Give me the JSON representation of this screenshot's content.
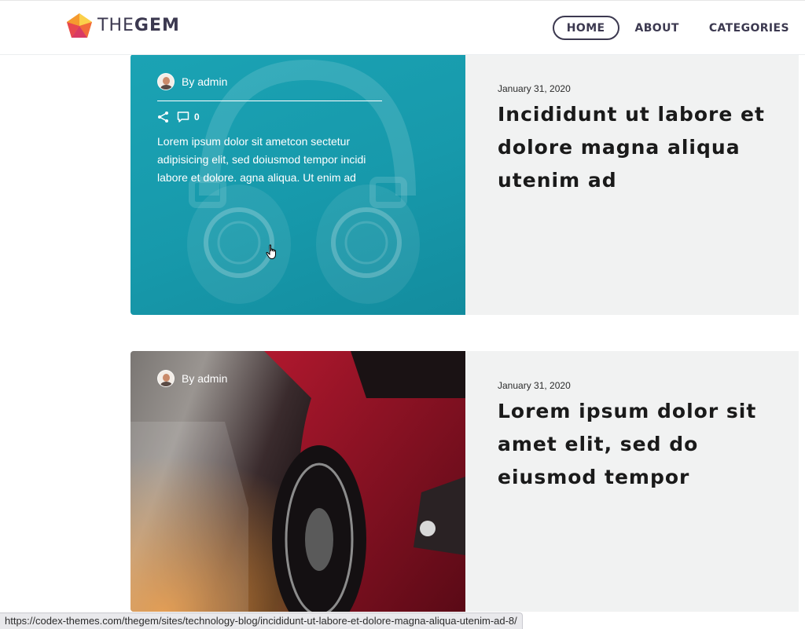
{
  "header": {
    "logo": {
      "text_light": "THE",
      "text_bold": "GEM"
    },
    "nav": {
      "home": "HOME",
      "about": "ABOUT",
      "categories": "CATEGORIES"
    }
  },
  "posts": [
    {
      "author": "By admin",
      "comment_count": "0",
      "excerpt": "Lorem ipsum dolor sit ametcon sectetur adipisicing elit, sed doiusmod tempor incidi labore et dolore. agna aliqua. Ut enim ad",
      "date": "January 31, 2020",
      "title": "Incididunt ut labore et dolore magna aliqua utenim ad",
      "image": "headphones",
      "overlay_color": "#1ba3b4"
    },
    {
      "author": "By admin",
      "date": "January 31, 2020",
      "title": "Lorem ipsum dolor sit amet elit, sed do eiusmod tempor",
      "image": "red-car"
    }
  ],
  "status_bar": {
    "url": "https://codex-themes.com/thegem/sites/technology-blog/incididunt-ut-labore-et-dolore-magna-aliqua-utenim-ad-8/"
  },
  "colors": {
    "nav_text": "#3c3950",
    "panel_bg": "#f1f2f2",
    "teal": "#1ba3b4"
  }
}
